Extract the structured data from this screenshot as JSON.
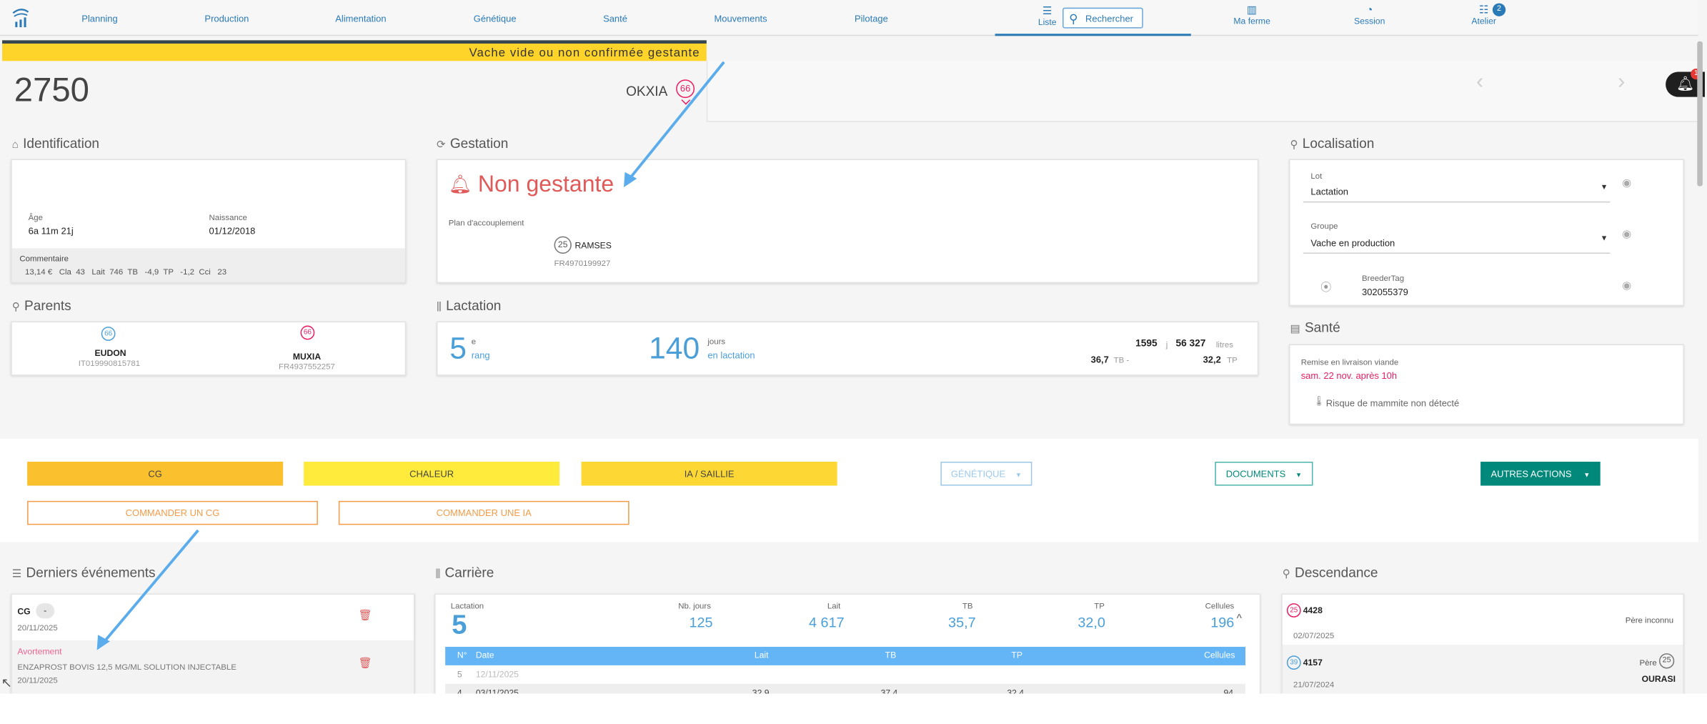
{
  "nav": {
    "items": [
      "Planning",
      "Production",
      "Alimentation",
      "Génétique",
      "Santé",
      "Mouvements",
      "Pilotage"
    ],
    "liste_label": "Liste",
    "search_placeholder": "Rechercher",
    "ferme_label": "Ma ferme",
    "session_label": "Session",
    "atelier_label": "Atelier",
    "atelier_badge": "2"
  },
  "banner": {
    "text": "Vache vide ou non confirmée gestante"
  },
  "animal": {
    "number": "2750",
    "name": "OKXIA",
    "badge": "66"
  },
  "notifications": {
    "count": "1"
  },
  "identification": {
    "title": "Identification",
    "age_label": "Âge",
    "age_value": "6a 11m 21j",
    "naissance_label": "Naissance",
    "naissance_value": "01/12/2018",
    "commentaire_label": "Commentaire",
    "stats": "13,14 €   Cla  43   Lait  746  TB   -4,9  TP   -1,2  Cci   23"
  },
  "parents": {
    "title": "Parents",
    "father_badge": "66",
    "father_name": "EUDON",
    "father_id": "IT019990815781",
    "mother_badge": "66",
    "mother_name": "MUXIA",
    "mother_id": "FR4937552257"
  },
  "gestation": {
    "title": "Gestation",
    "status": "Non gestante",
    "plan_label": "Plan d'accouplement",
    "bull_badge": "25",
    "bull_name": "RAMSES",
    "bull_id": "FR4970199927"
  },
  "lactation": {
    "title": "Lactation",
    "rank": "5",
    "rank_sup": "e",
    "rank_label": "rang",
    "days": "140",
    "days_unit": "jours",
    "days_label": "en lactation",
    "days_total": "1595",
    "days_total_unit": "j",
    "litres": "56 327",
    "litres_unit": "litres",
    "tb": "36,7",
    "tb_label": "TB -",
    "tp": "32,2",
    "tp_label": "TP"
  },
  "localisation": {
    "title": "Localisation",
    "lot_label": "Lot",
    "lot_value": "Lactation",
    "groupe_label": "Groupe",
    "groupe_value": "Vache en production",
    "tag_label": "BreederTag",
    "tag_value": "302055379"
  },
  "sante": {
    "title": "Santé",
    "remise_label": "Remise en livraison viande",
    "remise_value": "sam. 22 nov. après 10h",
    "mammite": "Risque de mammite non détecté"
  },
  "actions": {
    "cg": "CG",
    "chaleur": "CHALEUR",
    "ia": "IA / SAILLIE",
    "genetique": "GÉNÉTIQUE",
    "documents": "DOCUMENTS",
    "autres": "AUTRES ACTIONS",
    "commander_cg": "COMMANDER UN CG",
    "commander_ia": "COMMANDER UNE IA"
  },
  "events": {
    "title": "Derniers événements",
    "items": [
      {
        "type": "CG",
        "chip": "-",
        "detail": "",
        "date": "20/11/2025"
      },
      {
        "type": "Avortement",
        "chip": "",
        "detail": "ENZAPROST BOVIS 12,5 MG/ML SOLUTION INJECTABLE",
        "date": "20/11/2025"
      }
    ]
  },
  "carriere": {
    "title": "Carrière",
    "summary": {
      "lactation_label": "Lactation",
      "lactation_value": "5",
      "jours_label": "Nb. jours",
      "jours_value": "125",
      "lait_label": "Lait",
      "lait_value": "4 617",
      "tb_label": "TB",
      "tb_value": "35,7",
      "tp_label": "TP",
      "tp_value": "32,0",
      "cellules_label": "Cellules",
      "cellules_value": "196"
    },
    "columns": [
      "N°",
      "Date",
      "Lait",
      "TB",
      "TP",
      "Cellules"
    ],
    "rows": [
      [
        "5",
        "12/11/2025",
        "",
        "",
        "",
        ""
      ],
      [
        "4",
        "03/11/2025",
        "32,9",
        "37,4",
        "32,4",
        "94"
      ]
    ]
  },
  "descendance": {
    "title": "Descendance",
    "items": [
      {
        "badge": "25",
        "number": "4428",
        "date": "02/07/2025",
        "father_label": "Père inconnu",
        "father_badge": "",
        "father_name": ""
      },
      {
        "badge": "39",
        "number": "4157",
        "date": "21/07/2024",
        "father_label": "Père",
        "father_badge": "25",
        "father_name": "OURASI"
      }
    ]
  },
  "colors": {
    "accent": "#4a9fd8",
    "nav": "#2a7ab8",
    "alert": "#e05a5a",
    "banner": "#ffd42a",
    "cg": "#fbc02d",
    "chaleur": "#ffeb3b",
    "ia": "#fdd835",
    "teal": "#00897b",
    "orange": "#f39c4a",
    "pink": "#e91e63"
  }
}
